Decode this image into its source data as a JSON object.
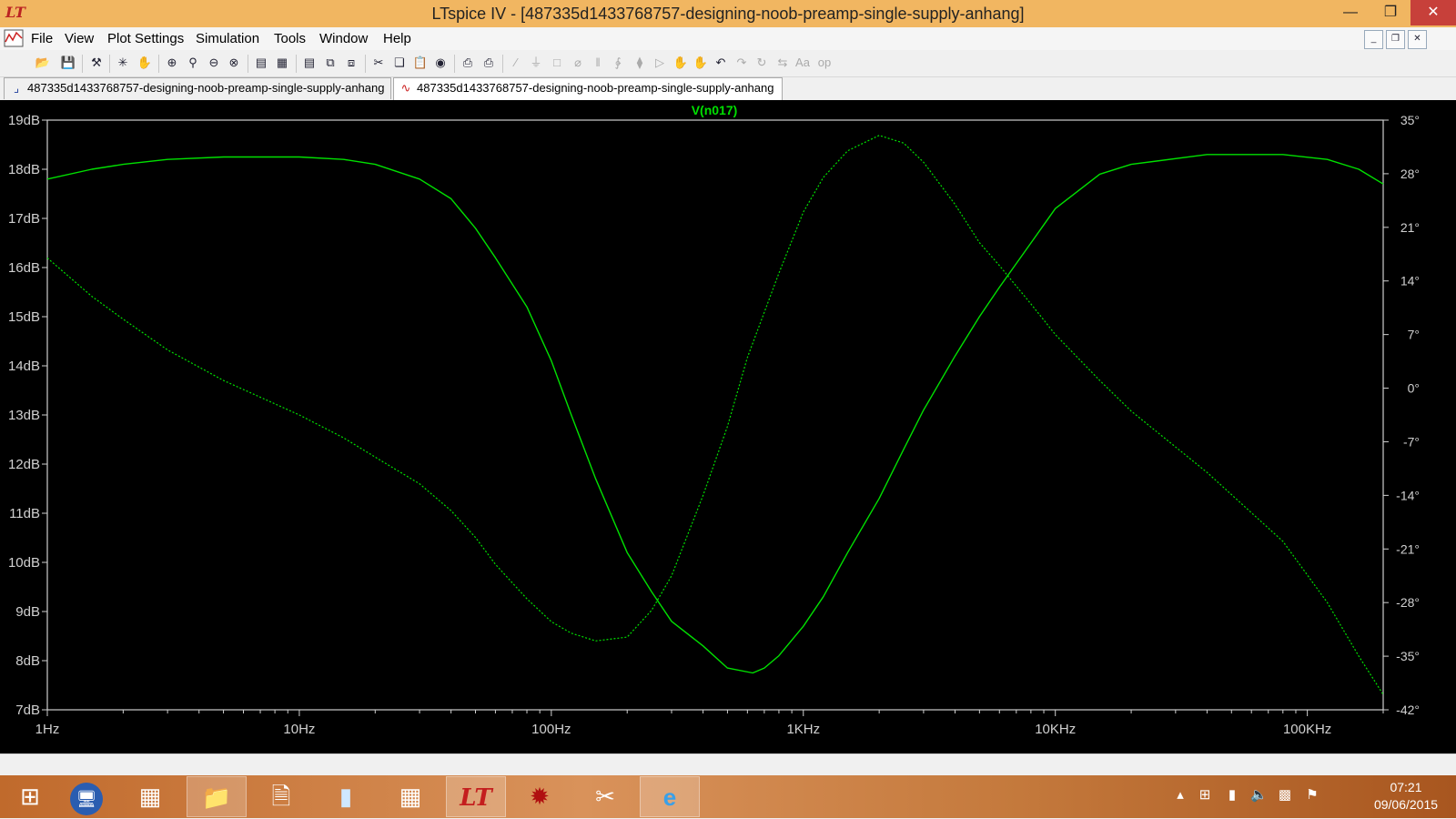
{
  "window": {
    "title": "LTspice IV - [487335d1433768757-designing-noob-preamp-single-supply-anhang]"
  },
  "menubar": {
    "items": [
      "File",
      "View",
      "Plot Settings",
      "Simulation",
      "Tools",
      "Window",
      "Help"
    ]
  },
  "tabs": [
    {
      "label": "487335d1433768757-designing-noob-preamp-single-supply-anhang",
      "type": "schematic",
      "active": false
    },
    {
      "label": "487335d1433768757-designing-noob-preamp-single-supply-anhang",
      "type": "waveform",
      "active": true
    }
  ],
  "chart_data": {
    "type": "line",
    "title": "V(n017)",
    "title_color": "#00e000",
    "background": "#000000",
    "x_scale": "log",
    "x_units": "Hz",
    "xlim": [
      1,
      200000
    ],
    "x_tick_values": [
      1,
      10,
      100,
      1000,
      10000,
      100000
    ],
    "x_tick_labels": [
      "1Hz",
      "10Hz",
      "100Hz",
      "1KHz",
      "10KHz",
      "100KHz"
    ],
    "ylim_left": [
      7,
      19
    ],
    "y_left_unit": "dB",
    "y_left_tick_labels": [
      "19dB",
      "18dB",
      "17dB",
      "16dB",
      "15dB",
      "14dB",
      "13dB",
      "12dB",
      "11dB",
      "10dB",
      "9dB",
      "8dB",
      "7dB"
    ],
    "ylim_right": [
      -42,
      35
    ],
    "y_right_tick_labels": [
      "35°",
      "28°",
      "21°",
      "14°",
      "7°",
      "0°",
      "-7°",
      "-14°",
      "-21°",
      "-28°",
      "-35°",
      "-42°"
    ],
    "grid": false,
    "series": [
      {
        "name": "magnitude",
        "axis": "left",
        "style": "solid",
        "color": "#00e000",
        "x": [
          1,
          1.5,
          2,
          3,
          5,
          10,
          15,
          20,
          30,
          40,
          50,
          60,
          80,
          100,
          120,
          150,
          200,
          250,
          300,
          400,
          500,
          630,
          700,
          800,
          1000,
          1200,
          1500,
          2000,
          2500,
          3000,
          4000,
          5000,
          6000,
          8000,
          10000,
          15000,
          20000,
          40000,
          80000,
          120000,
          160000,
          200000
        ],
        "y": [
          17.8,
          18.0,
          18.1,
          18.2,
          18.25,
          18.25,
          18.2,
          18.1,
          17.8,
          17.4,
          16.8,
          16.2,
          15.2,
          14.1,
          13.0,
          11.7,
          10.2,
          9.4,
          8.8,
          8.3,
          7.85,
          7.75,
          7.85,
          8.1,
          8.7,
          9.3,
          10.2,
          11.3,
          12.3,
          13.1,
          14.2,
          15.0,
          15.6,
          16.5,
          17.2,
          17.9,
          18.1,
          18.3,
          18.3,
          18.2,
          18.0,
          17.7
        ]
      },
      {
        "name": "phase",
        "axis": "right",
        "style": "dotted",
        "color": "#00e000",
        "x": [
          1,
          1.5,
          2,
          3,
          5,
          10,
          15,
          20,
          30,
          40,
          50,
          60,
          80,
          100,
          120,
          150,
          200,
          250,
          300,
          400,
          500,
          600,
          800,
          1000,
          1200,
          1500,
          2000,
          2500,
          3000,
          4000,
          5000,
          6000,
          8000,
          10000,
          15000,
          20000,
          40000,
          80000,
          120000,
          160000,
          200000
        ],
        "y": [
          17,
          12,
          9,
          5,
          1,
          -3.5,
          -6.5,
          -9,
          -12.5,
          -16,
          -19.5,
          -23,
          -27.5,
          -30.5,
          -32,
          -33,
          -32.5,
          -29,
          -24.5,
          -14,
          -5,
          4,
          15,
          23,
          27.5,
          31,
          33,
          32,
          29.5,
          24,
          19,
          16,
          11,
          7,
          1,
          -3,
          -11,
          -20,
          -28,
          -35,
          -40
        ]
      }
    ]
  },
  "taskbar": {
    "apps": [
      "start-windows",
      "remote-desktop",
      "firewall",
      "file-explorer",
      "blank-document",
      "notepad-editor",
      "calculator",
      "ltspice",
      "paint-splat",
      "snipping-tool",
      "internet-explorer"
    ],
    "clock_time": "07:21",
    "clock_date": "09/06/2015"
  },
  "colors": {
    "titlebar": "#f1b661",
    "plot_background": "#000000",
    "trace": "#00e000",
    "axis": "#d0d0d0"
  }
}
